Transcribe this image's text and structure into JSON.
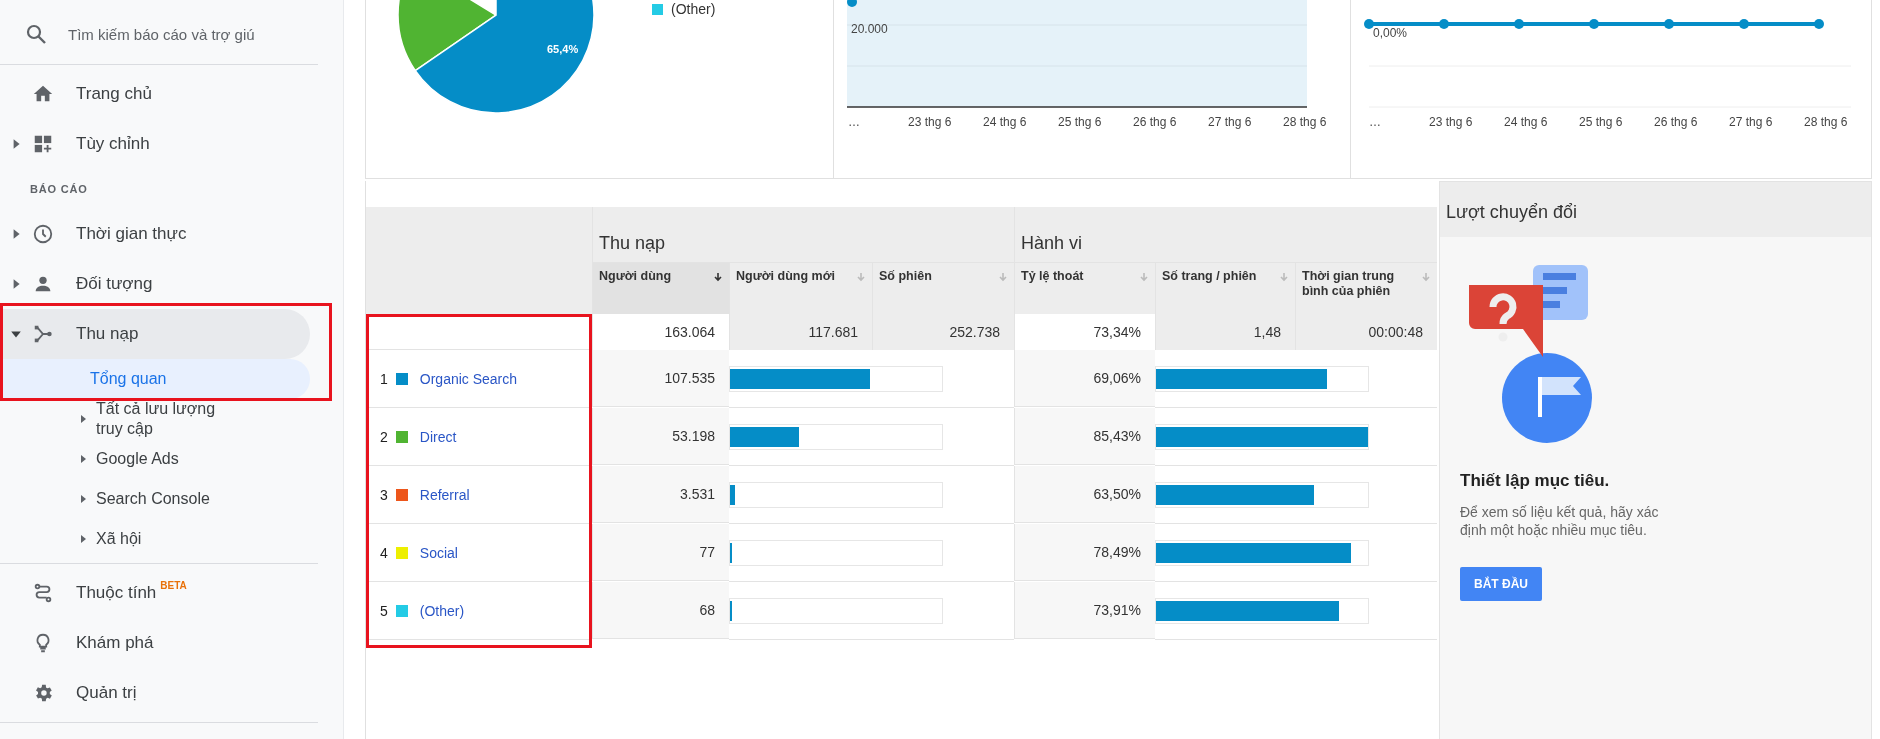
{
  "sidebar": {
    "search": {
      "placeholder": "Tìm kiếm báo cáo và trợ giú"
    },
    "groups": [
      {
        "items": [
          {
            "kind": "link",
            "label": "Trang chủ",
            "selected": false
          },
          {
            "kind": "link",
            "label": "Tùy chỉnh",
            "expanded": false,
            "selected": false
          },
          {
            "kind": "heading",
            "label": "BÁO CÁO"
          },
          {
            "kind": "link",
            "label": "Thời gian thực",
            "expanded": false,
            "selected": false
          },
          {
            "kind": "link",
            "label": "Đối tượng",
            "expanded": false,
            "selected": false
          },
          {
            "kind": "link",
            "label": "Thu nạp",
            "expanded": true,
            "selected": true,
            "highlighted": true,
            "children": [
              {
                "label": "Tổng quan",
                "selected": true
              },
              {
                "label": "Tất cả lưu lượng truy cập",
                "expanded": false,
                "selected": false
              },
              {
                "label": "Google Ads",
                "expanded": false,
                "selected": false
              },
              {
                "label": "Search Console",
                "expanded": false,
                "selected": false
              },
              {
                "label": "Xã hội",
                "expanded": false,
                "selected": false
              }
            ]
          }
        ]
      },
      {
        "items": [
          {
            "kind": "link",
            "label": "Thuộc tính",
            "badge": "BETA",
            "selected": false
          },
          {
            "kind": "link",
            "label": "Khám phá",
            "selected": false
          },
          {
            "kind": "link",
            "label": "Quản trị",
            "selected": false
          }
        ]
      }
    ]
  },
  "charts": {
    "pie": {
      "slice_label": "65,4%",
      "legend": [
        {
          "label": "(Other)",
          "color": "#24cbe5"
        }
      ]
    },
    "users_line": {
      "y_label": "20.000",
      "x_labels": [
        "…",
        "23 thg 6",
        "24 thg 6",
        "25 thg 6",
        "26 thg 6",
        "27 thg 6",
        "28 thg 6"
      ]
    },
    "rate_line": {
      "y_label": "0,00%",
      "x_labels": [
        "…",
        "23 thg 6",
        "24 thg 6",
        "25 thg 6",
        "26 thg 6",
        "27 thg 6",
        "28 thg 6"
      ]
    }
  },
  "table": {
    "dimension_column_highlighted": true,
    "groups": [
      {
        "title": "Thu nạp"
      },
      {
        "title": "Hành vi"
      }
    ],
    "columns": [
      {
        "label": "Người dùng",
        "sorted": true
      },
      {
        "label": "Người dùng mới",
        "sorted": false
      },
      {
        "label": "Số phiên",
        "sorted": false
      },
      {
        "label": "Tỷ lệ thoát",
        "sorted": false
      },
      {
        "label": "Số trang / phiên",
        "sorted": false
      },
      {
        "label": "Thời gian trung bình của phiên",
        "sorted": false
      }
    ],
    "totals": [
      "163.064",
      "117.681",
      "252.738",
      "73,34%",
      "1,48",
      "00:00:48"
    ],
    "rows": [
      {
        "index": "1",
        "label": "Organic Search",
        "color": "#058dc7",
        "users": {
          "value": "107.535",
          "level": 0.659
        },
        "bounce": {
          "value": "69,06%",
          "level": 0.808
        }
      },
      {
        "index": "2",
        "label": "Direct",
        "color": "#50b432",
        "users": {
          "value": "53.198",
          "level": 0.326
        },
        "bounce": {
          "value": "85,43%",
          "level": 1.0
        }
      },
      {
        "index": "3",
        "label": "Referral",
        "color": "#ed561b",
        "users": {
          "value": "3.531",
          "level": 0.0217
        },
        "bounce": {
          "value": "63,50%",
          "level": 0.743
        }
      },
      {
        "index": "4",
        "label": "Social",
        "color": "#edef00",
        "users": {
          "value": "77",
          "level": 0.0005
        },
        "bounce": {
          "value": "78,49%",
          "level": 0.919
        }
      },
      {
        "index": "5",
        "label": "(Other)",
        "color": "#24cbe5",
        "users": {
          "value": "68",
          "level": 0.0004
        },
        "bounce": {
          "value": "73,91%",
          "level": 0.865
        }
      }
    ]
  },
  "conversions": {
    "title": "Lượt chuyển đổi",
    "heading": "Thiết lập mục tiêu.",
    "description": "Để xem số liệu kết quả, hãy xác định một hoặc nhiều mục tiêu.",
    "button": "BẮT ĐẦU"
  }
}
